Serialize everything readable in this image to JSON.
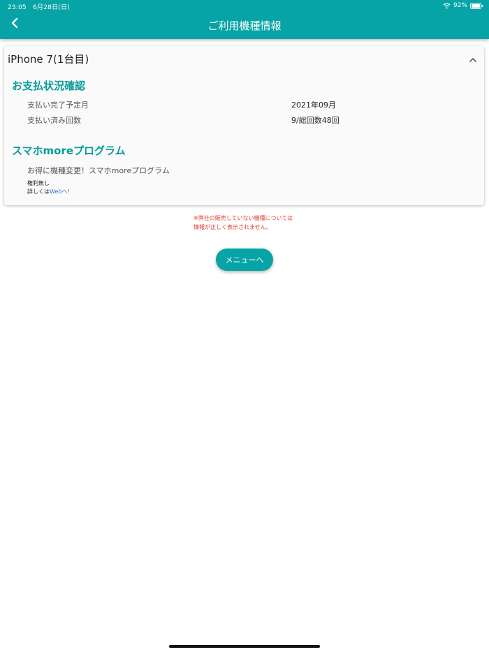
{
  "status_bar": {
    "time": "23:05",
    "date": "6月28日(日)",
    "battery": "92%"
  },
  "header": {
    "title": "ご利用機種情報",
    "background": "#06a4a6"
  },
  "device_card": {
    "title": "iPhone 7(1台目)",
    "payment": {
      "heading": "お支払状況確認",
      "rows": [
        {
          "label": "支払い完了予定月",
          "value": "2021年09月"
        },
        {
          "label": "支払い済み回数",
          "value": "9/総回数48回"
        }
      ]
    },
    "program": {
      "heading": "スマホmoreプログラム",
      "description": "お得に機種変更！スマホmoreプログラム",
      "rights": "権利無し",
      "details_prefix": "詳しくは",
      "details_link": "Webへ！"
    }
  },
  "notice": {
    "line1": "※弊社の販売していない機種については",
    "line2": "情報が正しく表示されません。"
  },
  "menu_button": {
    "label": "メニューへ"
  },
  "colors": {
    "accent": "#06a4a6",
    "heading": "#0a9a9b",
    "notice": "#e03a2f",
    "link": "#2f72d6"
  },
  "icons": {
    "back": "chevron-left-icon",
    "collapse": "chevron-up-icon",
    "wifi": "wifi-icon",
    "battery": "battery-icon"
  }
}
